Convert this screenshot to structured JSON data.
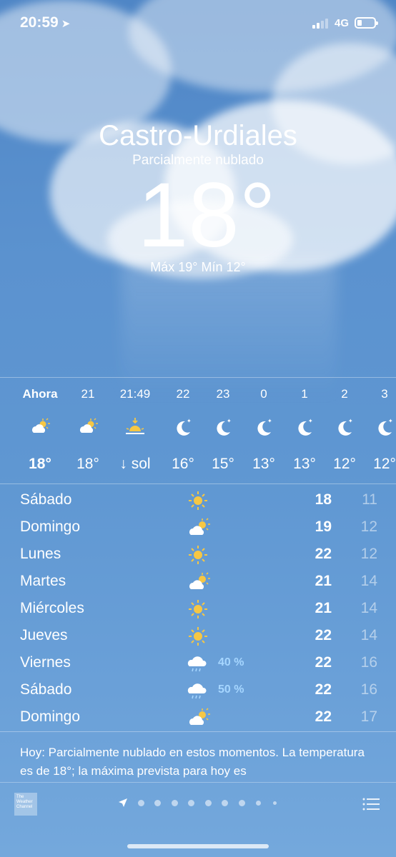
{
  "status_bar": {
    "time": "20:59",
    "network": "4G"
  },
  "location": {
    "city": "Castro-Urdiales",
    "condition": "Parcialmente nublado",
    "temperature": "18°",
    "high_low": "Máx 19° Mín 12°"
  },
  "hourly": [
    {
      "label": "Ahora",
      "icon": "partly-cloudy-sun-icon",
      "temp": "18°"
    },
    {
      "label": "21",
      "icon": "partly-cloudy-sun-icon",
      "temp": "18°"
    },
    {
      "label": "21:49",
      "icon": "sunset-icon",
      "temp": "↓ sol"
    },
    {
      "label": "22",
      "icon": "moon-stars-icon",
      "temp": "16°"
    },
    {
      "label": "23",
      "icon": "moon-stars-icon",
      "temp": "15°"
    },
    {
      "label": "0",
      "icon": "moon-stars-icon",
      "temp": "13°"
    },
    {
      "label": "1",
      "icon": "moon-stars-icon",
      "temp": "13°"
    },
    {
      "label": "2",
      "icon": "moon-stars-icon",
      "temp": "12°"
    },
    {
      "label": "3",
      "icon": "moon-stars-icon",
      "temp": "12°"
    }
  ],
  "daily": [
    {
      "day": "Sábado",
      "icon": "sun-icon",
      "precip": "",
      "max": "18",
      "min": "11"
    },
    {
      "day": "Domingo",
      "icon": "partly-cloudy-sun-icon",
      "precip": "",
      "max": "19",
      "min": "12"
    },
    {
      "day": "Lunes",
      "icon": "sun-icon",
      "precip": "",
      "max": "22",
      "min": "12"
    },
    {
      "day": "Martes",
      "icon": "partly-cloudy-sun-icon",
      "precip": "",
      "max": "21",
      "min": "14"
    },
    {
      "day": "Miércoles",
      "icon": "sun-icon",
      "precip": "",
      "max": "21",
      "min": "14"
    },
    {
      "day": "Jueves",
      "icon": "sun-icon",
      "precip": "",
      "max": "22",
      "min": "14"
    },
    {
      "day": "Viernes",
      "icon": "rain-cloud-icon",
      "precip": "40 %",
      "max": "22",
      "min": "16"
    },
    {
      "day": "Sábado",
      "icon": "rain-cloud-icon",
      "precip": "50 %",
      "max": "22",
      "min": "16"
    },
    {
      "day": "Domingo",
      "icon": "partly-cloudy-sun-icon",
      "precip": "",
      "max": "22",
      "min": "17"
    }
  ],
  "summary": "Hoy: Parcialmente nublado en estos momentos. La temperatura es de 18°; la máxima prevista para hoy es",
  "footer": {
    "logo": "The Weather Channel",
    "page_count": 9,
    "active_page": 0
  },
  "colors": {
    "sun": "#f6c744",
    "precip": "#a6d6ff",
    "sky": "#5f97d2"
  }
}
